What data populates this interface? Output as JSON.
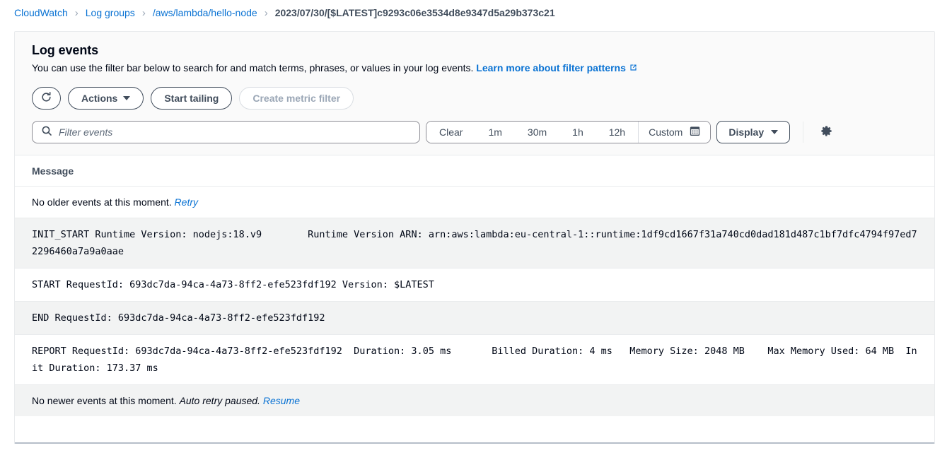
{
  "breadcrumb": {
    "items": [
      {
        "label": "CloudWatch",
        "current": false
      },
      {
        "label": "Log groups",
        "current": false
      },
      {
        "label": "/aws/lambda/hello-node",
        "current": false
      },
      {
        "label": "2023/07/30/[$LATEST]c9293c06e3534d8e9347d5a29b373c21",
        "current": true
      }
    ],
    "separator": "›"
  },
  "card": {
    "title": "Log events",
    "description": "You can use the filter bar below to search for and match terms, phrases, or values in your log events.",
    "learn_more_label": "Learn more about filter patterns"
  },
  "toolbar": {
    "refresh_icon": "refresh-icon",
    "actions_label": "Actions",
    "start_tailing_label": "Start tailing",
    "create_metric_filter_label": "Create metric filter",
    "create_metric_filter_disabled": true
  },
  "filter": {
    "search_placeholder": "Filter events",
    "search_value": "",
    "search_icon": "search-icon",
    "ranges": [
      "Clear",
      "1m",
      "30m",
      "1h",
      "12h"
    ],
    "custom_label": "Custom",
    "custom_icon": "calendar-icon",
    "display_label": "Display",
    "settings_icon": "gear-icon"
  },
  "table": {
    "column_header": "Message",
    "top_status": {
      "text": "No older events at this moment.",
      "link": "Retry"
    },
    "bottom_status": {
      "text": "No newer events at this moment.",
      "note": "Auto retry paused.",
      "link": "Resume"
    },
    "rows": [
      {
        "message": "INIT_START Runtime Version: nodejs:18.v9\tRuntime Version ARN: arn:aws:lambda:eu-central-1::runtime:1df9cd1667f31a740cd0dad181d487c1bf7dfc4794f97ed72296460a7a9a0aae"
      },
      {
        "message": "START RequestId: 693dc7da-94ca-4a73-8ff2-efe523fdf192 Version: $LATEST"
      },
      {
        "message": "END RequestId: 693dc7da-94ca-4a73-8ff2-efe523fdf192"
      },
      {
        "message": "REPORT RequestId: 693dc7da-94ca-4a73-8ff2-efe523fdf192\tDuration: 3.05 ms\tBilled Duration: 4 ms\tMemory Size: 2048 MB\tMax Memory Used: 64 MB\tInit Duration: 173.37 ms"
      }
    ]
  },
  "colors": {
    "link": "#0972d3",
    "text": "#000716",
    "muted": "#5f6b7a",
    "border": "#e9ebed",
    "stripe": "#f2f3f3"
  }
}
